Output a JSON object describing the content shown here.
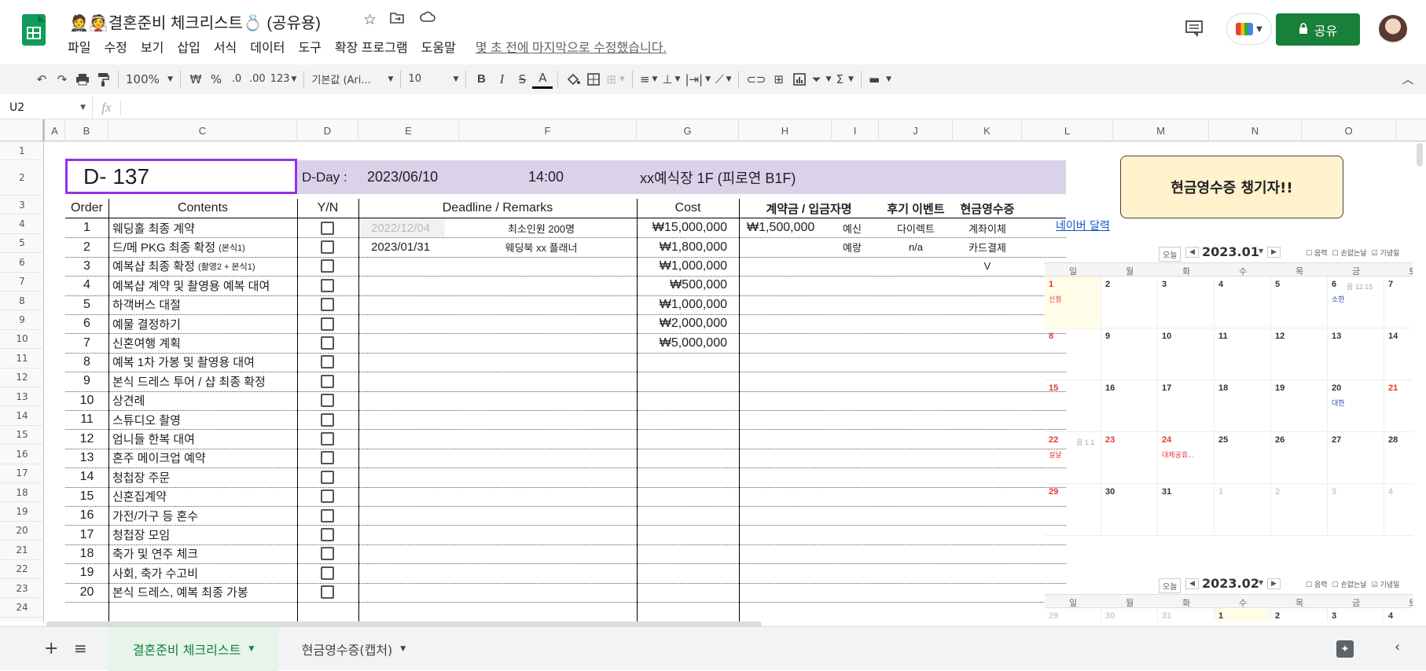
{
  "app": {
    "title": "🤵👰결혼준비 체크리스트💍 (공유용)",
    "menu": [
      "파일",
      "수정",
      "보기",
      "삽입",
      "서식",
      "데이터",
      "도구",
      "확장 프로그램",
      "도움말"
    ],
    "last_edit": "몇 초 전에 마지막으로 수정했습니다.",
    "share_label": "공유",
    "colors": {
      "green": "#188038",
      "share_bg": "#188038",
      "purple": "#9334e6",
      "header_band": "#d9d2e9",
      "note_bg": "#fff2cc",
      "calendar_today": "#fffde7"
    }
  },
  "toolbar": {
    "zoom": "100%",
    "currency": "₩",
    "percent": "%",
    "dec_less": ".0",
    "dec_more": ".00",
    "format_123": "123",
    "font": "기본값 (Ari...",
    "font_size": "10",
    "bold": "B",
    "italic": "I",
    "strike": "S",
    "text_color": "A"
  },
  "formula_bar": {
    "cell_ref": "U2",
    "fx": "fx"
  },
  "columns": [
    "A",
    "B",
    "C",
    "D",
    "E",
    "F",
    "G",
    "H",
    "I",
    "J",
    "K",
    "L",
    "M",
    "N",
    "O"
  ],
  "rows": [
    "1",
    "2",
    "3",
    "4",
    "5",
    "6",
    "7",
    "8",
    "9",
    "10",
    "11",
    "12",
    "13",
    "14",
    "15",
    "16",
    "17",
    "18",
    "19",
    "20",
    "21",
    "22",
    "23",
    "24"
  ],
  "sheet": {
    "dday_label": "D- 137",
    "dday_colon": "D-Day :",
    "date": "2023/06/10",
    "time": "14:00",
    "venue": "xx예식장 1F (피로연 B1F)",
    "note": "현금영수증 챙기자!!",
    "naver_link": "네이버 달력",
    "headers": {
      "order": "Order",
      "contents": "Contents",
      "yn": "Y/N",
      "deadline": "Deadline / Remarks",
      "cost": "Cost",
      "deposit": "계약금 / 입금자명",
      "review": "후기 이벤트",
      "receipt": "현금영수증"
    },
    "items": [
      {
        "order": "1",
        "content": "웨딩홀 최종 계약",
        "sub": "",
        "deadline": "2022/12/04",
        "remark": "최소인원 200명",
        "cost": "₩15,000,000",
        "deposit": "₩1,500,000",
        "payer": "예신",
        "review": "다이렉트",
        "receipt": "계좌이체"
      },
      {
        "order": "2",
        "content": "드/메 PKG 최종 확정",
        "sub": "(본식1)",
        "deadline": "2023/01/31",
        "remark": "웨딩북 xx 플래너",
        "cost": "₩1,800,000",
        "deposit": "",
        "payer": "예랑",
        "review": "n/a",
        "receipt": "카드결제"
      },
      {
        "order": "3",
        "content": "예복샵 최종 확정",
        "sub": "(촬영2 + 본식1)",
        "deadline": "",
        "remark": "",
        "cost": "₩1,000,000",
        "deposit": "",
        "payer": "",
        "review": "",
        "receipt": "V"
      },
      {
        "order": "4",
        "content": "예복샵 계약 및 촬영용 예복 대여",
        "sub": "",
        "deadline": "",
        "remark": "",
        "cost": "₩500,000",
        "deposit": "",
        "payer": "",
        "review": "",
        "receipt": ""
      },
      {
        "order": "5",
        "content": "하객버스 대절",
        "sub": "",
        "deadline": "",
        "remark": "",
        "cost": "₩1,000,000",
        "deposit": "",
        "payer": "",
        "review": "",
        "receipt": ""
      },
      {
        "order": "6",
        "content": "예물 결정하기",
        "sub": "",
        "deadline": "",
        "remark": "",
        "cost": "₩2,000,000",
        "deposit": "",
        "payer": "",
        "review": "",
        "receipt": ""
      },
      {
        "order": "7",
        "content": "신혼여행 계획",
        "sub": "",
        "deadline": "",
        "remark": "",
        "cost": "₩5,000,000",
        "deposit": "",
        "payer": "",
        "review": "",
        "receipt": ""
      },
      {
        "order": "8",
        "content": "예복 1차 가봉 및 촬영용 대여",
        "sub": "",
        "deadline": "",
        "remark": "",
        "cost": "",
        "deposit": "",
        "payer": "",
        "review": "",
        "receipt": ""
      },
      {
        "order": "9",
        "content": "본식 드레스 투어 / 샵 최종 확정",
        "sub": "",
        "deadline": "",
        "remark": "",
        "cost": "",
        "deposit": "",
        "payer": "",
        "review": "",
        "receipt": ""
      },
      {
        "order": "10",
        "content": "상견례",
        "sub": "",
        "deadline": "",
        "remark": "",
        "cost": "",
        "deposit": "",
        "payer": "",
        "review": "",
        "receipt": ""
      },
      {
        "order": "11",
        "content": "스튜디오 촬영",
        "sub": "",
        "deadline": "",
        "remark": "",
        "cost": "",
        "deposit": "",
        "payer": "",
        "review": "",
        "receipt": ""
      },
      {
        "order": "12",
        "content": "엄니들 한복 대여",
        "sub": "",
        "deadline": "",
        "remark": "",
        "cost": "",
        "deposit": "",
        "payer": "",
        "review": "",
        "receipt": ""
      },
      {
        "order": "13",
        "content": "혼주 메이크업 예약",
        "sub": "",
        "deadline": "",
        "remark": "",
        "cost": "",
        "deposit": "",
        "payer": "",
        "review": "",
        "receipt": ""
      },
      {
        "order": "14",
        "content": "청첩장 주문",
        "sub": "",
        "deadline": "",
        "remark": "",
        "cost": "",
        "deposit": "",
        "payer": "",
        "review": "",
        "receipt": ""
      },
      {
        "order": "15",
        "content": "신혼집계약",
        "sub": "",
        "deadline": "",
        "remark": "",
        "cost": "",
        "deposit": "",
        "payer": "",
        "review": "",
        "receipt": ""
      },
      {
        "order": "16",
        "content": "가전/가구 등 혼수",
        "sub": "",
        "deadline": "",
        "remark": "",
        "cost": "",
        "deposit": "",
        "payer": "",
        "review": "",
        "receipt": ""
      },
      {
        "order": "17",
        "content": "청첩장 모임",
        "sub": "",
        "deadline": "",
        "remark": "",
        "cost": "",
        "deposit": "",
        "payer": "",
        "review": "",
        "receipt": ""
      },
      {
        "order": "18",
        "content": "축가 및 연주 체크",
        "sub": "",
        "deadline": "",
        "remark": "",
        "cost": "",
        "deposit": "",
        "payer": "",
        "review": "",
        "receipt": ""
      },
      {
        "order": "19",
        "content": "사회, 축가 수고비",
        "sub": "",
        "deadline": "",
        "remark": "",
        "cost": "",
        "deposit": "",
        "payer": "",
        "review": "",
        "receipt": ""
      },
      {
        "order": "20",
        "content": "본식 드레스, 예복 최종 가봉",
        "sub": "",
        "deadline": "",
        "remark": "",
        "cost": "",
        "deposit": "",
        "payer": "",
        "review": "",
        "receipt": ""
      }
    ]
  },
  "calendar1": {
    "today_btn": "오늘",
    "month": "2023.01",
    "options": [
      "음력",
      "손없는날",
      "기념일"
    ],
    "weekdays": [
      "일",
      "월",
      "화",
      "수",
      "목",
      "금",
      "토"
    ],
    "weeks": [
      [
        "1",
        "2",
        "3",
        "4",
        "5",
        "6",
        "7"
      ],
      [
        "8",
        "9",
        "10",
        "11",
        "12",
        "13",
        "14"
      ],
      [
        "15",
        "16",
        "17",
        "18",
        "19",
        "20",
        "21"
      ],
      [
        "22",
        "23",
        "24",
        "25",
        "26",
        "27",
        "28"
      ],
      [
        "29",
        "30",
        "31",
        "1",
        "2",
        "3",
        "4"
      ]
    ],
    "events": {
      "newyear": "신정",
      "sohan": "소한",
      "lunar_1": "음 12.15",
      "daehan": "대한",
      "lunar_22": "음 1.1",
      "seollal": "설날",
      "substitute": "대체공휴..."
    }
  },
  "calendar2": {
    "today_btn": "오늘",
    "month": "2023.02",
    "options": [
      "음력",
      "손없는날",
      "기념일"
    ],
    "weekdays": [
      "일",
      "월",
      "화",
      "수",
      "목",
      "금",
      "토"
    ],
    "first_row": [
      "29",
      "30",
      "31",
      "1",
      "2",
      "3",
      "4"
    ]
  },
  "tabs": [
    {
      "label": "결혼준비 체크리스트",
      "active": true
    },
    {
      "label": "현금영수증(캡처)",
      "active": false
    }
  ]
}
